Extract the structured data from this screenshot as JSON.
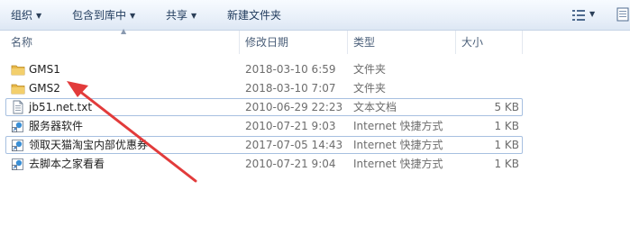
{
  "toolbar": {
    "organize": "组织",
    "include_library": "包含到库中",
    "share": "共享",
    "new_folder": "新建文件夹"
  },
  "columns": {
    "name": "名称",
    "date": "修改日期",
    "type": "类型",
    "size": "大小"
  },
  "files": [
    {
      "name": "GMS1",
      "date": "2018-03-10 6:59",
      "type": "文件夹",
      "size": "",
      "icon": "folder-icon"
    },
    {
      "name": "GMS2",
      "date": "2018-03-10 7:07",
      "type": "文件夹",
      "size": "",
      "icon": "folder-icon"
    },
    {
      "name": "jb51.net.txt",
      "date": "2010-06-29 22:23",
      "type": "文本文档",
      "size": "5 KB",
      "icon": "text-file-icon"
    },
    {
      "name": "服务器软件",
      "date": "2010-07-21 9:03",
      "type": "Internet 快捷方式",
      "size": "1 KB",
      "icon": "internet-shortcut-icon"
    },
    {
      "name": "领取天猫淘宝内部优惠券",
      "date": "2017-07-05 14:43",
      "type": "Internet 快捷方式",
      "size": "1 KB",
      "icon": "internet-shortcut-icon"
    },
    {
      "name": "去脚本之家看看",
      "date": "2010-07-21 9:04",
      "type": "Internet 快捷方式",
      "size": "1 KB",
      "icon": "internet-shortcut-icon"
    }
  ],
  "colors": {
    "annotation_arrow": "#e23b3b",
    "folder": "#e8b84a",
    "toolbar_text": "#1e395b",
    "selection_border": "#a7c0e0"
  }
}
